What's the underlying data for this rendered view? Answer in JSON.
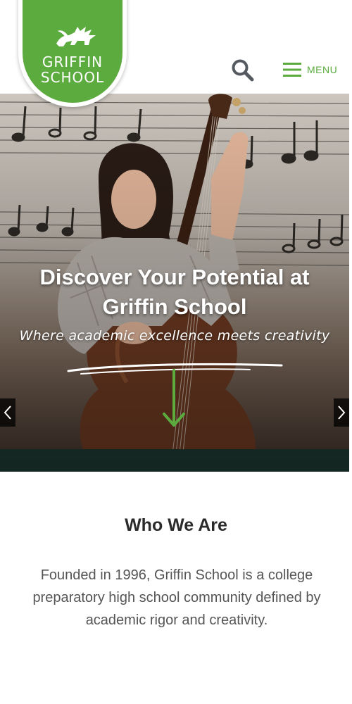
{
  "header": {
    "logo_line1": "GRIFFIN",
    "logo_line2": "SCHOOL",
    "menu_label": "MENU",
    "brand_color": "#5cab3f",
    "icons": [
      "griffin-logo-icon",
      "search-icon",
      "hamburger-icon"
    ]
  },
  "hero": {
    "title": "Discover Your Potential at Griffin School",
    "subtitle": "Where academic excellence meets creativity",
    "icons": [
      "arrow-down-icon",
      "chevron-left-icon",
      "chevron-right-icon"
    ]
  },
  "about": {
    "title": "Who We Are",
    "body": "Founded in 1996, Griffin School is a college preparatory high school community defined by academic rigor and creativity."
  }
}
